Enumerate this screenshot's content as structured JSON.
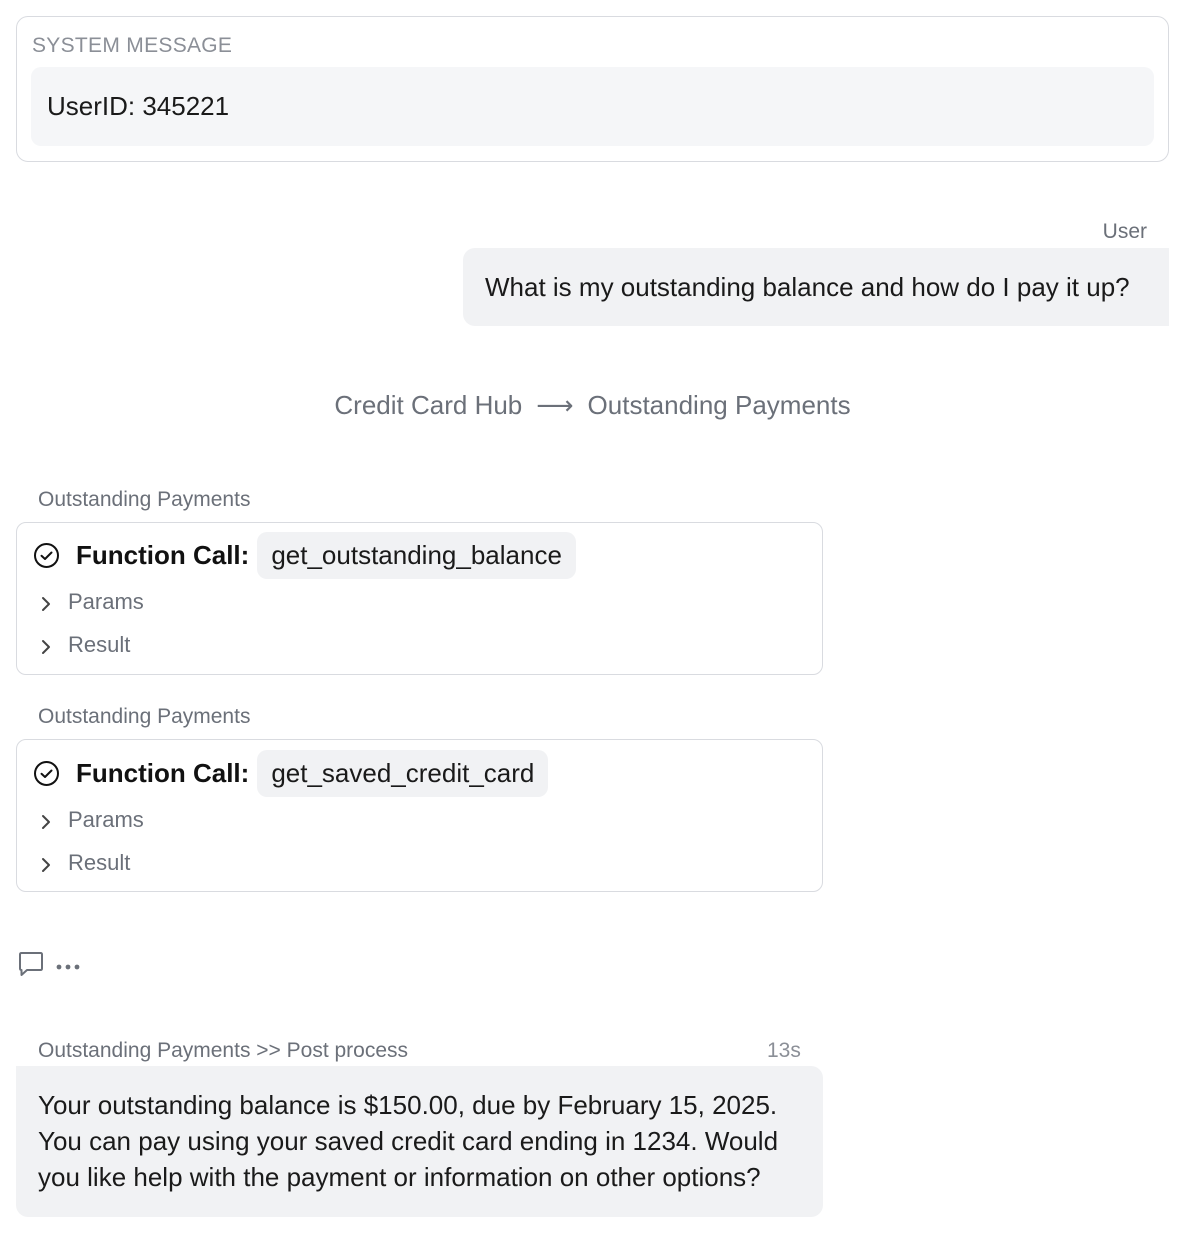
{
  "system_message": {
    "title": "SYSTEM MESSAGE",
    "text": "UserID: 345221"
  },
  "user_message": {
    "label": "User",
    "text": "What is my outstanding balance and how do I pay it up?"
  },
  "route": {
    "from": "Credit Card Hub",
    "arrow": "⟶",
    "to": "Outstanding Payments"
  },
  "function_calls": [
    {
      "label": "Outstanding Payments",
      "title": "Function Call:",
      "name": "get_outstanding_balance",
      "params_label": "Params",
      "result_label": "Result"
    },
    {
      "label": "Outstanding Payments",
      "title": "Function Call:",
      "name": "get_saved_credit_card",
      "params_label": "Params",
      "result_label": "Result"
    }
  ],
  "actions": {
    "comment_icon": "comment-icon",
    "more_icon": "more-horizontal-icon"
  },
  "assistant_response": {
    "label": "Outstanding Payments >> Post process",
    "time": "13s",
    "text": "Your outstanding balance is $150.00, due by February 15, 2025. You can pay using your saved credit card ending in 1234. Would you like help with the payment or information on other options?"
  }
}
